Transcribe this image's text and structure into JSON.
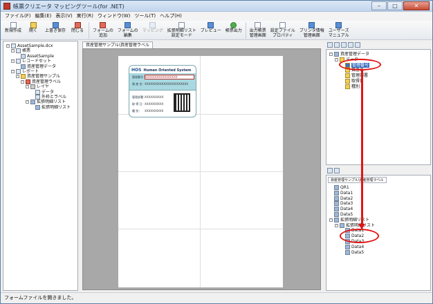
{
  "window": {
    "title": "帳票クリエータ マッピングツール(for .NET)",
    "min": "–",
    "max": "□",
    "close": "✕"
  },
  "menu": [
    "ファイル(F)",
    "編集(E)",
    "表示(V)",
    "実行(R)",
    "ウィンドウ(W)",
    "ツール(T)",
    "ヘルプ(H)"
  ],
  "toolbar": [
    {
      "label": "新規作成",
      "icon": "new-doc-icon"
    },
    {
      "label": "開く",
      "icon": "open-folder-icon"
    },
    {
      "label": "上書き保存",
      "icon": "save-icon"
    },
    {
      "label": "閉じる",
      "icon": "close-doc-icon"
    },
    {
      "label": "フォームの\n追加",
      "icon": "add-form-icon"
    },
    {
      "label": "フォームの\n編集",
      "icon": "edit-form-icon"
    },
    {
      "label": "マッピング",
      "icon": "mapping-icon",
      "disabled": true
    },
    {
      "label": "拡張明細リスト\n設定モード",
      "icon": "detail-list-icon"
    },
    {
      "label": "プレビュー",
      "icon": "preview-icon"
    },
    {
      "label": "帳票出力",
      "icon": "output-icon"
    },
    {
      "label": "出力帳票\n管理画面",
      "icon": "output-manage-icon"
    },
    {
      "label": "設定ファイル\nプロパティ",
      "icon": "settings-file-icon"
    },
    {
      "label": "プリンタ情報\n管理画面",
      "icon": "printer-icon"
    },
    {
      "label": "ユーザーズ\nマニュアル",
      "icon": "manual-icon"
    }
  ],
  "left_tree": [
    {
      "label": "AssetSample.dcx",
      "level": 0,
      "exp": "-",
      "icon": "ti"
    },
    {
      "label": "帳票",
      "level": 1,
      "exp": "-",
      "icon": "ti"
    },
    {
      "label": "AssetSample",
      "level": 2,
      "exp": "",
      "icon": "rep"
    },
    {
      "label": "レコードセット",
      "level": 1,
      "exp": "-",
      "icon": "ti"
    },
    {
      "label": "資産管理データ",
      "level": 2,
      "exp": "",
      "icon": "dat"
    },
    {
      "label": "レポート",
      "level": 1,
      "exp": "-",
      "icon": "ti"
    },
    {
      "label": "資産管理サンプル",
      "level": 2,
      "exp": "-",
      "icon": "fold"
    },
    {
      "label": "資産管理ラベル",
      "level": 3,
      "exp": "-",
      "icon": "red"
    },
    {
      "label": "レイヤ",
      "level": 4,
      "exp": "-",
      "icon": "lay"
    },
    {
      "label": "データ",
      "level": 5,
      "exp": "",
      "icon": "ti"
    },
    {
      "label": "外枠とラベル",
      "level": 5,
      "exp": "",
      "icon": "ti"
    },
    {
      "label": "拡張明細リスト",
      "level": 4,
      "exp": "-",
      "icon": "dat"
    },
    {
      "label": "拡張明細リスト",
      "level": 5,
      "exp": "",
      "icon": "dat"
    }
  ],
  "doc_tab": "資産管理サンプル\\資産管理ラベル",
  "card": {
    "logo": "HOS",
    "brand": "Human Oriented System",
    "row1_label": "管理番号：",
    "row1_value": "XXXXXXXXXXXXXXXXX",
    "row2_label": "資 産 名：",
    "row2_value": "XXXXXXXXXXXXXXXXXXXXXXX",
    "row3_label": "管理部署：",
    "row3_value": "XXXXXXXXXX",
    "row4_label": "取 得 日：",
    "row4_value": "XXXXXXXXXX",
    "row5_label": "種    別：",
    "row5_value": "XXXXXXXXXX"
  },
  "right_top_tree": [
    {
      "label": "資産管理データ",
      "level": 0,
      "exp": "-",
      "icon": "dat"
    },
    {
      "label": "データ",
      "level": 1,
      "exp": "-",
      "icon": "fold"
    },
    {
      "label": "管理番号",
      "level": 2,
      "exp": "",
      "icon": "fold",
      "selected": true
    },
    {
      "label": "資産名",
      "level": 2,
      "exp": "",
      "icon": "fold"
    },
    {
      "label": "管理部署",
      "level": 2,
      "exp": "",
      "icon": "fold"
    },
    {
      "label": "取得日",
      "level": 2,
      "exp": "",
      "icon": "fold"
    },
    {
      "label": "種別",
      "level": 2,
      "exp": "",
      "icon": "fold"
    }
  ],
  "right_bottom_tab": "資産管理サンプル\\資産管理ラベル",
  "right_bottom_tree": [
    {
      "label": "QR1",
      "level": 0,
      "exp": "",
      "icon": "dat"
    },
    {
      "label": "Data1",
      "level": 0,
      "exp": "",
      "icon": "dat"
    },
    {
      "label": "Data2",
      "level": 0,
      "exp": "",
      "icon": "dat"
    },
    {
      "label": "Data3",
      "level": 0,
      "exp": "",
      "icon": "dat"
    },
    {
      "label": "Data4",
      "level": 0,
      "exp": "",
      "icon": "dat"
    },
    {
      "label": "Data5",
      "level": 0,
      "exp": "",
      "icon": "dat"
    },
    {
      "label": "拡張明細リスト",
      "level": 0,
      "exp": "-",
      "icon": "dat"
    },
    {
      "label": "拡張明細リスト",
      "level": 1,
      "exp": "-",
      "icon": "dat"
    },
    {
      "label": "Data1",
      "level": 2,
      "exp": "",
      "icon": "dat"
    },
    {
      "label": "Data2",
      "level": 2,
      "exp": "",
      "icon": "dat"
    },
    {
      "label": "Data3",
      "level": 2,
      "exp": "",
      "icon": "dat"
    },
    {
      "label": "Data4",
      "level": 2,
      "exp": "",
      "icon": "dat"
    },
    {
      "label": "Data5",
      "level": 2,
      "exp": "",
      "icon": "dat"
    }
  ],
  "status": "フォームファイルを開きました。",
  "colors": {
    "accent_red": "#e21414",
    "selection_blue": "#3b6fc0",
    "label_band": "#a9d8e0"
  }
}
